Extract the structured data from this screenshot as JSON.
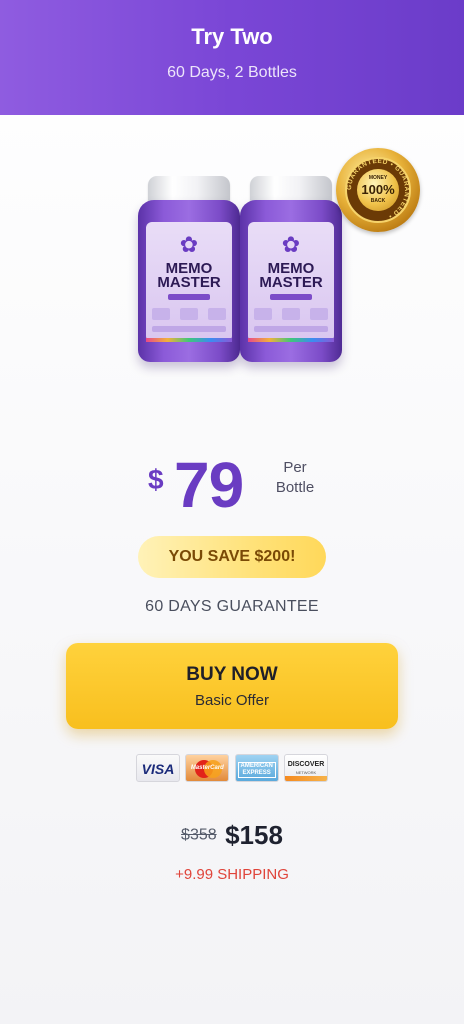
{
  "header": {
    "title": "Try Two",
    "subtitle": "60 Days, 2 Bottles"
  },
  "product": {
    "brand_line1": "MEMO",
    "brand_line2": "MASTER",
    "bottle_count": 2,
    "badge": {
      "top_text": "MONEY",
      "percent": "100%",
      "bottom_text": "BACK",
      "ring_text": "GUARANTEED • GUARANTEED •"
    }
  },
  "price": {
    "currency": "$",
    "amount": "79",
    "per_label_line1": "Per",
    "per_label_line2": "Bottle"
  },
  "savings": "YOU SAVE $200!",
  "guarantee": "60 DAYS GUARANTEE",
  "buy_button": {
    "label": "BUY NOW",
    "sublabel": "Basic Offer"
  },
  "payment_cards": {
    "visa": "VISA",
    "mastercard": "MasterCard",
    "amex": "AMERICAN EXPRESS",
    "discover": "DISCOVER",
    "discover_sub": "NETWORK"
  },
  "total": {
    "old_price": "$358",
    "new_price": "$158"
  },
  "shipping": "+9.99 SHIPPING",
  "colors": {
    "header_gradient_start": "#8f5ce0",
    "header_gradient_end": "#6b3cc9",
    "price": "#6a3cc2",
    "button": "#f8bf1e",
    "shipping": "#e0443a"
  }
}
